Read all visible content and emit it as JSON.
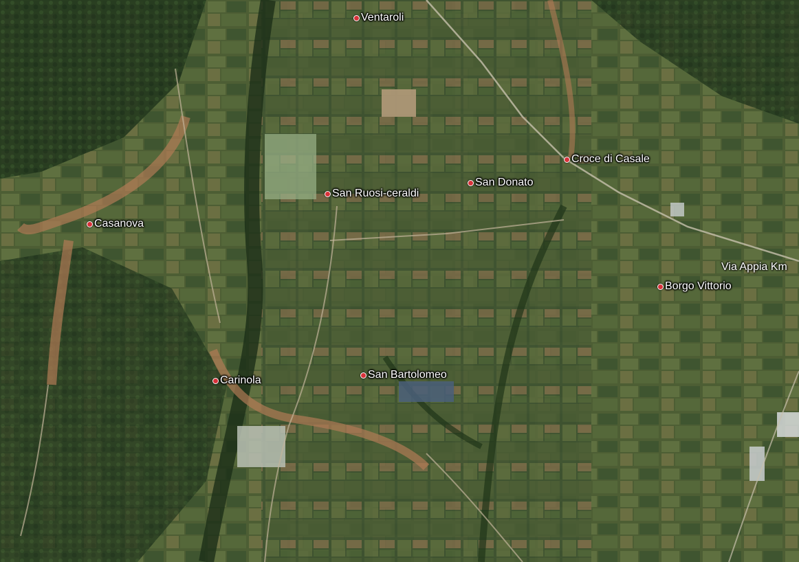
{
  "map": {
    "type": "satellite",
    "places": [
      {
        "id": "ventaroli",
        "name": "Ventaroli"
      },
      {
        "id": "croce-di-casale",
        "name": "Croce di Casale"
      },
      {
        "id": "san-donato",
        "name": "San Donato"
      },
      {
        "id": "san-ruosi-ceraldi",
        "name": "San Ruosi-ceraldi"
      },
      {
        "id": "casanova",
        "name": "Casanova"
      },
      {
        "id": "borgo-vittorio",
        "name": "Borgo Vittorio"
      },
      {
        "id": "carinola",
        "name": "Carinola"
      },
      {
        "id": "san-bartolomeo",
        "name": "San Bartolomeo"
      }
    ],
    "roads": [
      {
        "id": "via-appia",
        "name": "Via Appia Km"
      }
    ],
    "colors": {
      "vegetation": "#2e4a26",
      "fields": "#5b6b3a",
      "soil": "#8a6a4a",
      "settlement": "#b07a55",
      "pin": "#d8323a",
      "label": "#ffffff"
    }
  }
}
